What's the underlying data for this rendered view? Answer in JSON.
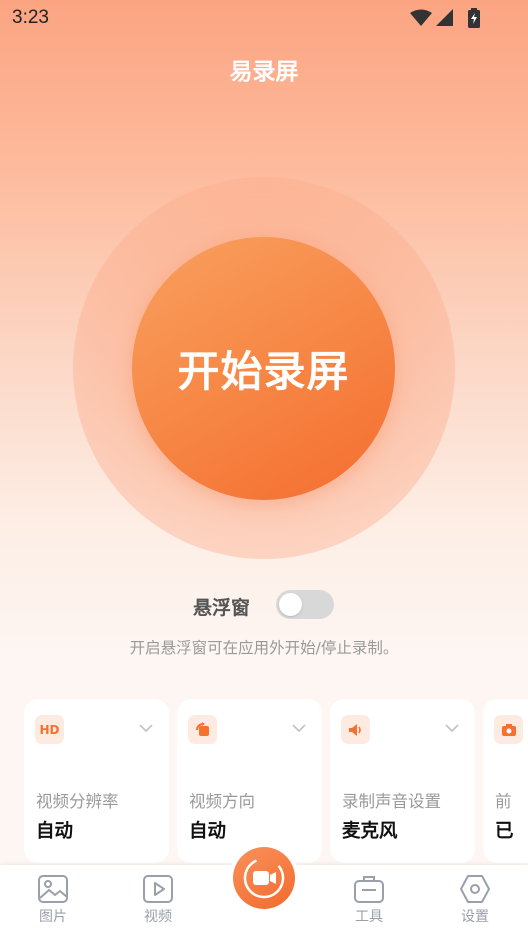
{
  "status_bar": {
    "time": "3:23",
    "icons": [
      "wifi-icon",
      "signal-icon",
      "battery-charging-icon"
    ]
  },
  "app": {
    "title": "易录屏"
  },
  "main": {
    "record_button_label": "开始录屏"
  },
  "floating_window": {
    "label": "悬浮窗",
    "enabled": false,
    "hint": "开启悬浮窗可在应用外开始/停止录制。"
  },
  "settings_cards": [
    {
      "icon": "hd-icon",
      "icon_text": "HD",
      "label": "视频分辨率",
      "value": "自动"
    },
    {
      "icon": "rotate-icon",
      "label": "视频方向",
      "value": "自动"
    },
    {
      "icon": "speaker-icon",
      "label": "录制声音设置",
      "value": "麦克风"
    },
    {
      "icon": "camera-icon",
      "label": "前",
      "value": "已"
    }
  ],
  "tab_bar": {
    "items": [
      {
        "label": "图片",
        "icon": "image-icon"
      },
      {
        "label": "视频",
        "icon": "video-play-icon"
      },
      {
        "label": "",
        "icon": "record-camera-icon"
      },
      {
        "label": "工具",
        "icon": "toolbox-icon"
      },
      {
        "label": "设置",
        "icon": "settings-hex-icon"
      }
    ]
  },
  "colors": {
    "accent": "#F4712F",
    "accent_light": "#FDEBE2",
    "tab_inactive": "#9AA0AB"
  }
}
